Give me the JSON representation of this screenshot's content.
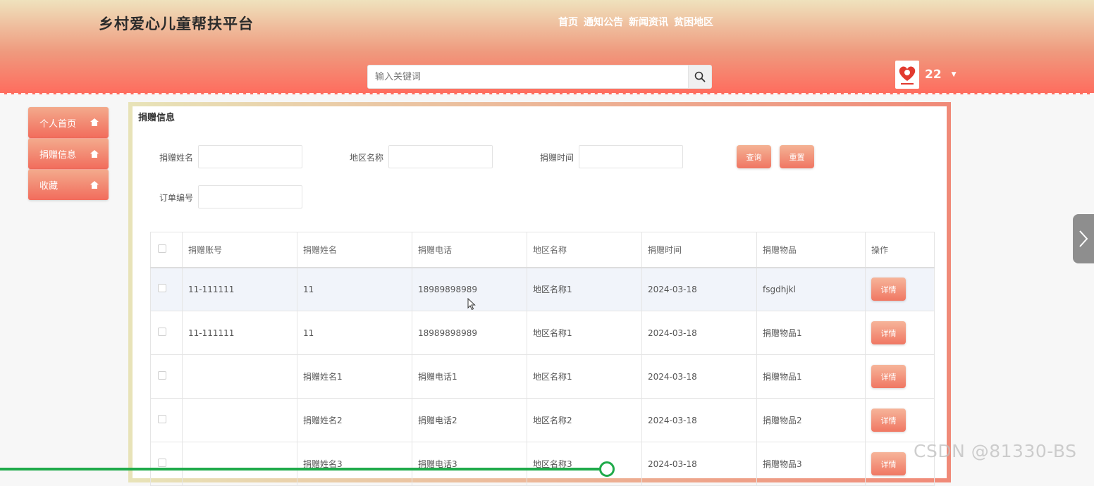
{
  "header": {
    "title": "乡村爱心儿童帮扶平台",
    "nav": [
      "首页",
      "通知公告",
      "新闻资讯",
      "贫困地区"
    ],
    "search_placeholder": "输入关键词",
    "username": "22"
  },
  "sidebar": {
    "items": [
      {
        "label": "个人首页",
        "icon": "home-icon"
      },
      {
        "label": "捐赠信息",
        "icon": "home-icon"
      },
      {
        "label": "收藏",
        "icon": "home-icon"
      }
    ]
  },
  "panel": {
    "title": "捐赠信息",
    "filters": {
      "donor_name_label": "捐赠姓名",
      "region_label": "地区名称",
      "time_label": "捐赠时间",
      "order_label": "订单编号"
    },
    "query_label": "查询",
    "reset_label": "重置"
  },
  "table": {
    "headers": [
      "捐赠账号",
      "捐赠姓名",
      "捐赠电话",
      "地区名称",
      "捐赠时间",
      "捐赠物品",
      "操作"
    ],
    "rows": [
      [
        "11-111111",
        "11",
        "18989898989",
        "地区名称1",
        "2024-03-18",
        "fsgdhjkl"
      ],
      [
        "11-111111",
        "11",
        "18989898989",
        "地区名称1",
        "2024-03-18",
        "捐赠物品1"
      ],
      [
        "",
        "捐赠姓名1",
        "捐赠电话1",
        "地区名称1",
        "2024-03-18",
        "捐赠物品1"
      ],
      [
        "",
        "捐赠姓名2",
        "捐赠电话2",
        "地区名称2",
        "2024-03-18",
        "捐赠物品2"
      ],
      [
        "",
        "捐赠姓名3",
        "捐赠电话3",
        "地区名称3",
        "2024-03-18",
        "捐赠物品3"
      ]
    ],
    "detail_label": "详情"
  },
  "watermark": "CSDN @81330-BS",
  "playback": {
    "progress": 0.555
  },
  "colors": {
    "accent": "#f26c5c",
    "progress": "#1faa4a"
  }
}
